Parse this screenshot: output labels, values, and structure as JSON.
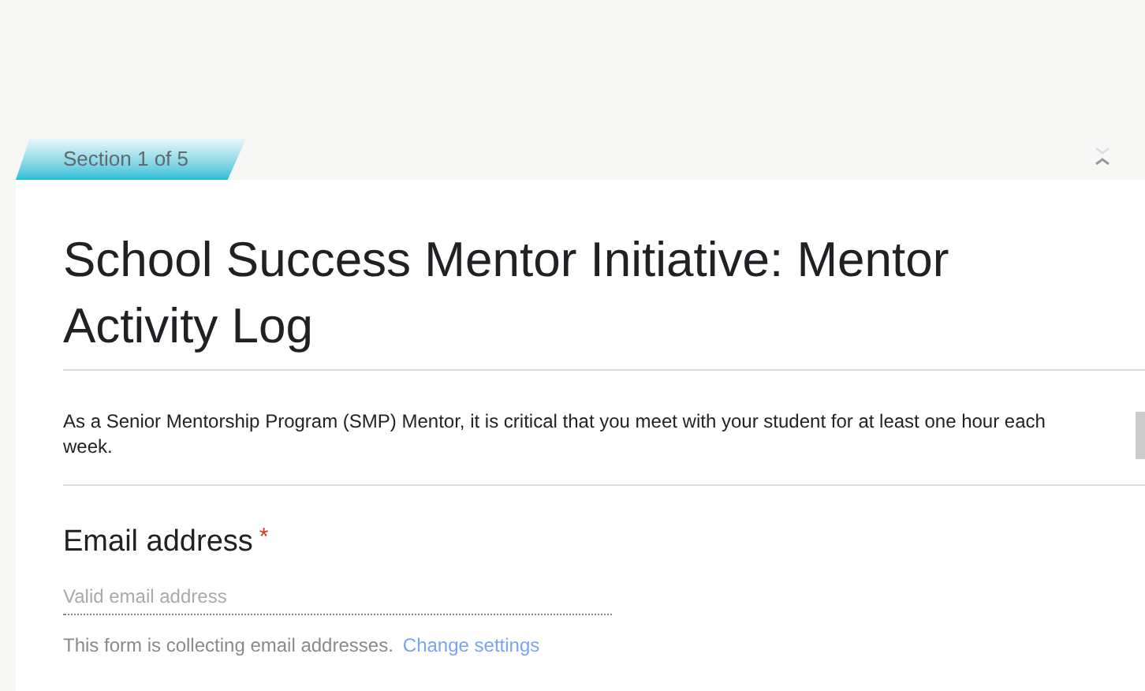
{
  "section_tab": {
    "label": "Section 1 of 5"
  },
  "form": {
    "title": "School Success Mentor Initiative: Mentor Activity Log",
    "description": "As a Senior Mentorship Program (SMP) Mentor, it is critical that you meet with your student for at least one hour each week.",
    "question": {
      "label": "Email address",
      "required": true,
      "required_mark": "*",
      "placeholder": "Valid email address"
    },
    "footer": {
      "text": "This form is collecting email addresses.",
      "link": "Change settings"
    }
  }
}
